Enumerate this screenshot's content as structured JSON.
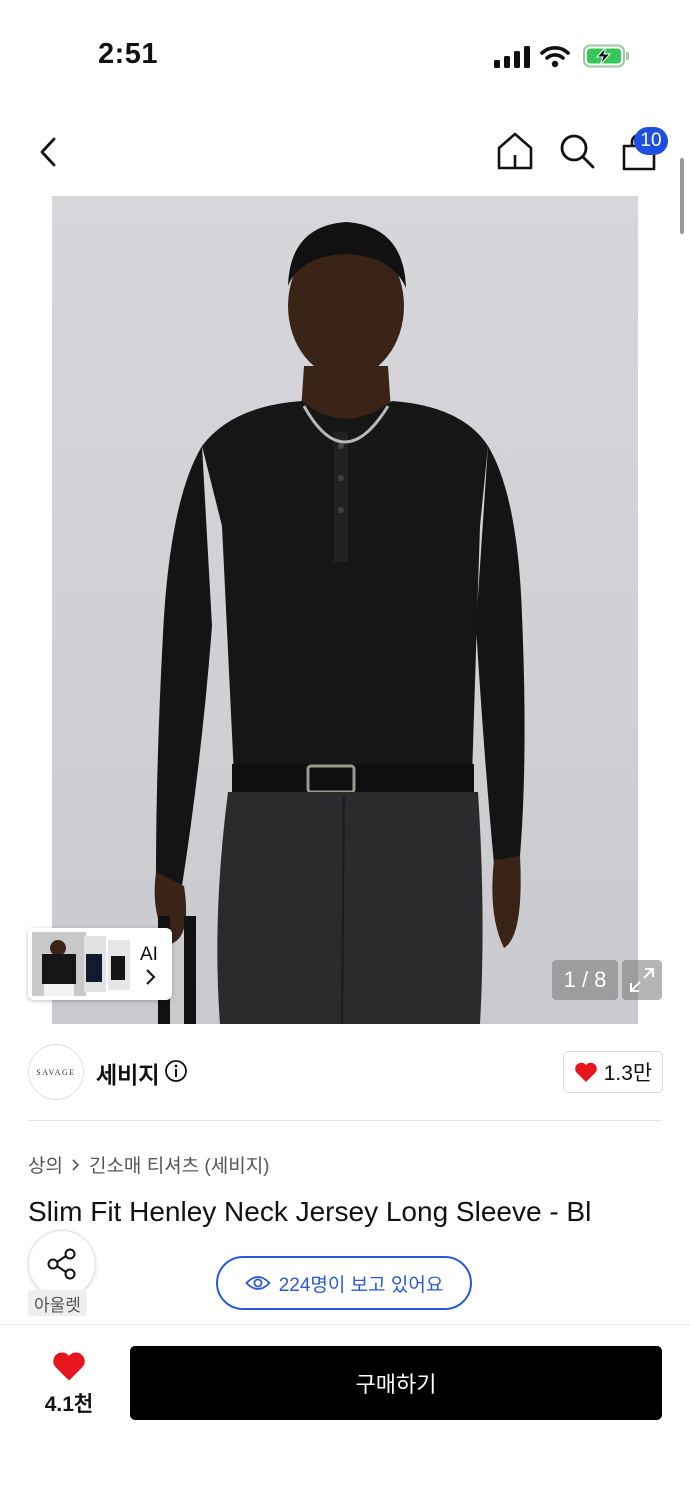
{
  "status_bar": {
    "time": "2:51",
    "icons": [
      "cellular-signal-icon",
      "wifi-icon",
      "battery-charging-icon"
    ]
  },
  "header": {
    "back_icon": "chevron-left-icon",
    "home_icon": "home-icon",
    "search_icon": "search-icon",
    "cart_icon": "shopping-bag-icon",
    "cart_count": "10"
  },
  "gallery": {
    "ai_label": "AI",
    "image_counter": "1 / 8",
    "expand_icon": "expand-icon"
  },
  "brand": {
    "logo_text": "SAVAGE",
    "name": "세비지",
    "likes": "1.3만"
  },
  "breadcrumb": {
    "category": "상의",
    "subcategory": "긴소매 티셔츠 (세비지)"
  },
  "product": {
    "title": "Slim Fit Henley Neck Jersey Long Sleeve - Bl"
  },
  "share": {
    "label": "아울렛"
  },
  "viewers": {
    "text": "224명이 보고 있어요"
  },
  "bottom_bar": {
    "wish_count": "4.1천",
    "buy_label": "구매하기"
  },
  "colors": {
    "accent_blue": "#2a58d8",
    "badge_blue": "#1f4fe0",
    "heart_red": "#e8141e",
    "battery_green": "#34c759"
  }
}
